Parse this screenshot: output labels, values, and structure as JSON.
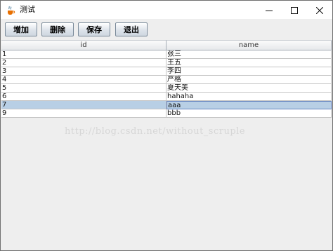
{
  "window": {
    "title": "测试",
    "icon": "java-coffee-cup-icon",
    "minimize_icon": "minimize-icon",
    "maximize_icon": "maximize-icon",
    "close_icon": "close-icon"
  },
  "toolbar": {
    "add_label": "增加",
    "delete_label": "删除",
    "save_label": "保存",
    "exit_label": "退出"
  },
  "table": {
    "columns": [
      "id",
      "name"
    ],
    "rows": [
      {
        "id": "1",
        "name": "张三"
      },
      {
        "id": "2",
        "name": "王五"
      },
      {
        "id": "3",
        "name": "李四"
      },
      {
        "id": "4",
        "name": "严格"
      },
      {
        "id": "5",
        "name": "夏天美"
      },
      {
        "id": "6",
        "name": "hahaha"
      },
      {
        "id": "7",
        "name": "aaa"
      },
      {
        "id": "9",
        "name": "bbb"
      }
    ],
    "selected_row_index": 6
  },
  "watermark": "http://blog.csdn.net/without_scruple",
  "colors": {
    "selection": "#b8cfe5",
    "window_bg": "#eeeeee"
  }
}
